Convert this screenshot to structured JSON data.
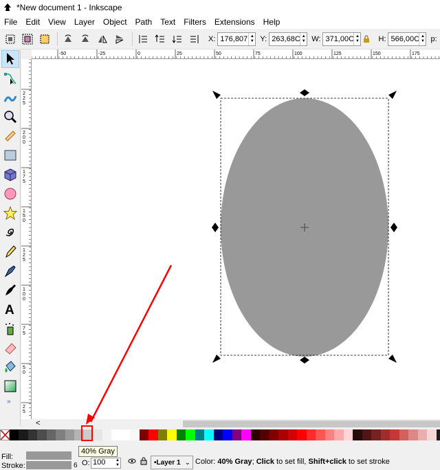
{
  "window": {
    "title": "*New document 1 - Inkscape"
  },
  "menu": [
    "File",
    "Edit",
    "View",
    "Layer",
    "Object",
    "Path",
    "Text",
    "Filters",
    "Extensions",
    "Help"
  ],
  "coords": {
    "x_label": "X:",
    "x_value": "176,807",
    "y_label": "Y:",
    "y_value": "263,68C",
    "w_label": "W:",
    "w_value": "371,00C",
    "h_label": "H:",
    "h_value": "566,00C",
    "unit": "p:"
  },
  "hruler_ticks": [
    "-50",
    "-25",
    "0",
    "25",
    "50",
    "75",
    "100",
    "125",
    "150",
    "175"
  ],
  "vruler_ticks": [
    "2,2,5",
    "2,0,0",
    "1,7,5",
    "1,5,0",
    "1,2,5",
    "1,0,0",
    "7,5",
    "5,0",
    "2,5"
  ],
  "tools": [
    "select-tool",
    "node-tool",
    "tweak-tool",
    "zoom-tool",
    "measure-tool",
    "rectangle-tool",
    "3d-box-tool",
    "ellipse-tool",
    "star-tool",
    "spiral-tool",
    "pencil-tool",
    "pen-tool",
    "calligraphy-tool",
    "text-tool",
    "spray-tool",
    "eraser-tool",
    "paint-bucket-tool",
    "gradient-tool"
  ],
  "toolbox_more": "»",
  "hscroll_left": "<",
  "palette": {
    "none_label": "X",
    "colors": [
      "#000000",
      "#1a1a1a",
      "#333333",
      "#4d4d4d",
      "#666666",
      "#808080",
      "#999999",
      "#b3b3b3",
      "#cccccc",
      "#e6e6e6",
      "#f2f2f2",
      "#ffffff",
      "#ffffff",
      "#f8f8f8",
      "#800000",
      "#ff0000",
      "#808000",
      "#ffff00",
      "#008000",
      "#00ff00",
      "#008080",
      "#00ffff",
      "#000080",
      "#0000ff",
      "#800080",
      "#ff00ff",
      "#2b0000",
      "#550000",
      "#800000",
      "#aa0000",
      "#d40000",
      "#ff0000",
      "#ff2a2a",
      "#ff5555",
      "#ff8080",
      "#ffaaaa",
      "#ffd5d5",
      "#280b0b",
      "#501616",
      "#782121",
      "#a02c2c",
      "#c83737",
      "#d35f5f",
      "#de8787",
      "#e9afaf",
      "#f4d7d7",
      "#241c1c",
      "#483737"
    ]
  },
  "tooltip": "40% Gray",
  "status": {
    "fill_label": "Fill:",
    "stroke_label": "Stroke:",
    "stroke_width": "6",
    "opacity_label": "O:",
    "opacity_value": "100",
    "layer": "•Layer 1",
    "msg_prefix": "Color: ",
    "msg_color": "40% Gray",
    "msg_mid": "; ",
    "msg_click": "Click",
    "msg_to_fill": " to set fill, ",
    "msg_shift": "Shift+click",
    "msg_to_stroke": " to set stroke"
  },
  "ellipse_fill": "#999999",
  "annotation_color": "#ff0000"
}
